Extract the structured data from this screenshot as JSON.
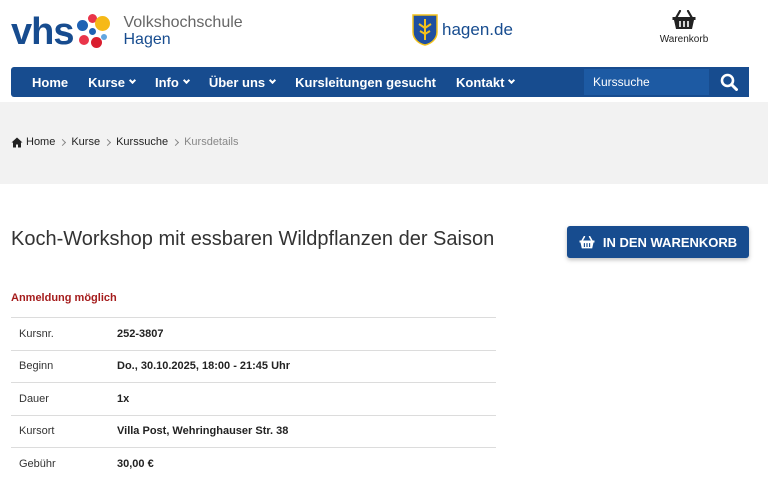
{
  "header": {
    "logo": {
      "brand": "vhs",
      "line1": "Volkshochschule",
      "line2": "Hagen"
    },
    "partner": {
      "label": "hagen.de"
    },
    "cart": {
      "label": "Warenkorb",
      "icon": "basket-icon"
    }
  },
  "nav": {
    "items": [
      {
        "label": "Home",
        "dropdown": false
      },
      {
        "label": "Kurse",
        "dropdown": true
      },
      {
        "label": "Info",
        "dropdown": true
      },
      {
        "label": "Über uns",
        "dropdown": true
      },
      {
        "label": "Kursleitungen gesucht",
        "dropdown": false
      },
      {
        "label": "Kontakt",
        "dropdown": true
      }
    ],
    "search": {
      "placeholder": "Kurssuche",
      "icon": "search-icon"
    }
  },
  "breadcrumb": {
    "items": [
      "Home",
      "Kurse",
      "Kurssuche"
    ],
    "current": "Kursdetails"
  },
  "course": {
    "title": "Koch-Workshop mit essbaren Wildpflanzen der Saison",
    "status": "Anmeldung möglich",
    "cart_button": "IN DEN WARENKORB",
    "details": [
      {
        "key": "Kursnr.",
        "value": "252-3807"
      },
      {
        "key": "Beginn",
        "value": "Do., 30.10.2025, 18:00 - 21:45 Uhr"
      },
      {
        "key": "Dauer",
        "value": "1x"
      },
      {
        "key": "Kursort",
        "value": "Villa Post, Wehringhauser Str. 38"
      },
      {
        "key": "Gebühr",
        "value": "30,00 €"
      }
    ]
  },
  "colors": {
    "brand_blue": "#174c8f",
    "status_red": "#a51c1c",
    "band_gray": "#f2f2f2"
  }
}
